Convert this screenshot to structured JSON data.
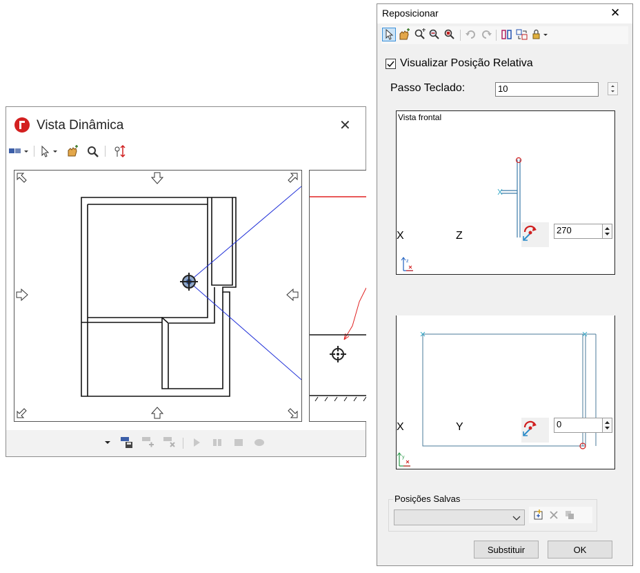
{
  "vista": {
    "title": "Vista Dinâmica",
    "close_glyph": "✕"
  },
  "repo": {
    "title": "Reposicionar",
    "close_glyph": "✕",
    "show_relative_checked": true,
    "show_relative_label": "Visualizar Posição Relativa",
    "step_label": "Passo Teclado:",
    "step_value": "10",
    "front_view": {
      "title": "Vista frontal",
      "axis_left": "X",
      "axis_right": "Z",
      "angle_value": "270"
    },
    "top_view": {
      "axis_left": "X",
      "axis_right": "Y",
      "angle_value": "0"
    },
    "saved_group_label": "Posições Salvas",
    "saved_value": "",
    "replace_button": "Substituir",
    "ok_button": "OK"
  }
}
